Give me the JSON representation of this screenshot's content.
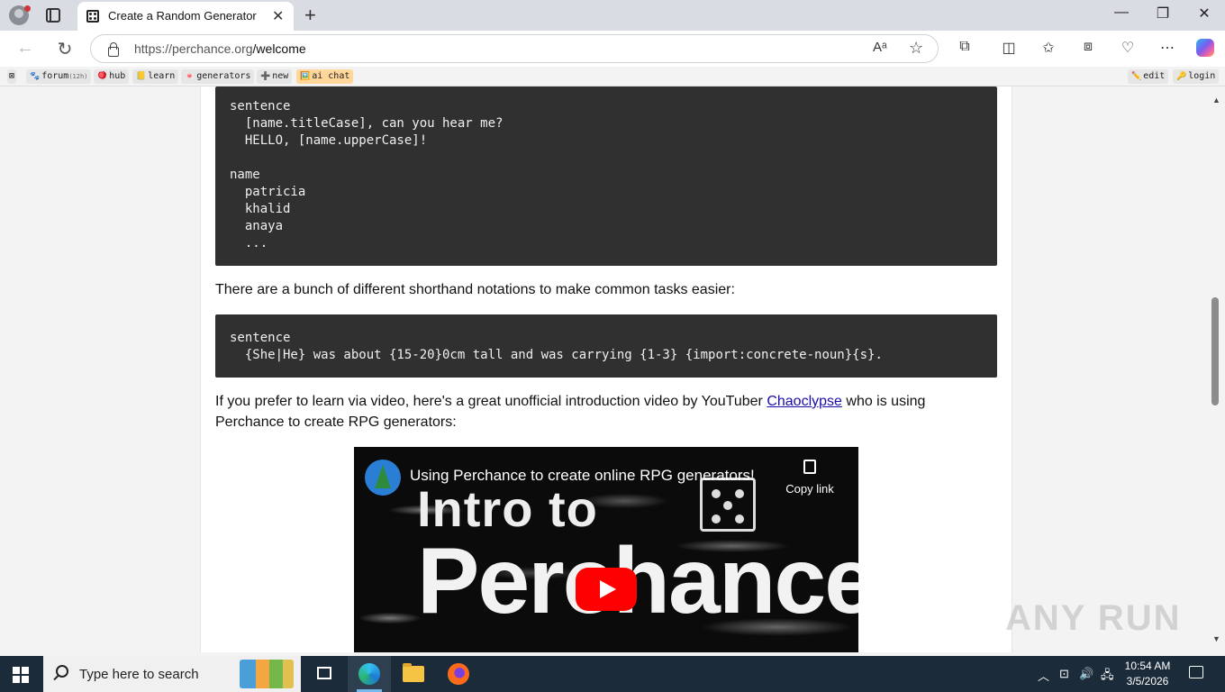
{
  "browser": {
    "tab_title": "Create a Random Generator",
    "tab_close": "✕",
    "new_tab": "+",
    "url_host": "https://perchance.org",
    "url_path": "/welcome",
    "window_controls": {
      "minimize": "—",
      "restore": "❐",
      "close": "✕"
    }
  },
  "site_nav": {
    "left": [
      {
        "icon": "🐾",
        "label": "forum",
        "badge": "(12h)"
      },
      {
        "icon": "🪀",
        "label": "hub"
      },
      {
        "icon": "📒",
        "label": "learn"
      },
      {
        "icon": "🍬",
        "label": "generators"
      },
      {
        "icon": "➕",
        "label": "new"
      },
      {
        "icon": "🖼️",
        "label": "ai chat"
      }
    ],
    "right": [
      {
        "icon": "✏️",
        "label": "edit"
      },
      {
        "icon": "🔑",
        "label": "login"
      }
    ]
  },
  "content": {
    "code1": "sentence\n  [name.titleCase], can you hear me?\n  HELLO, [name.upperCase]!\n\nname\n  patricia\n  khalid\n  anaya\n  ...",
    "para1": "There are a bunch of different shorthand notations to make common tasks easier:",
    "code2": "sentence\n  {She|He} was about {15-20}0cm tall and was carrying {1-3} {import:concrete-noun}{s}.",
    "para2_before": "If you prefer to learn via video, here's a great unofficial introduction video by YouTuber ",
    "para2_link": "Chaoclypse",
    "para2_after": " who is using Perchance to create RPG generators:",
    "video": {
      "title": "Using Perchance to create online RPG generators!",
      "copy_link": "Copy link",
      "thumb_line1": "Intro to",
      "thumb_line2": "Perchance"
    }
  },
  "watermark": "ANY RUN",
  "taskbar": {
    "search_placeholder": "Type here to search",
    "time": "10:54 AM",
    "date": "3/5/2026"
  },
  "colors": {
    "code_bg": "#303030",
    "link": "#1a0dab",
    "youtube_red": "#ff0000",
    "taskbar": "#1c2b3a"
  }
}
